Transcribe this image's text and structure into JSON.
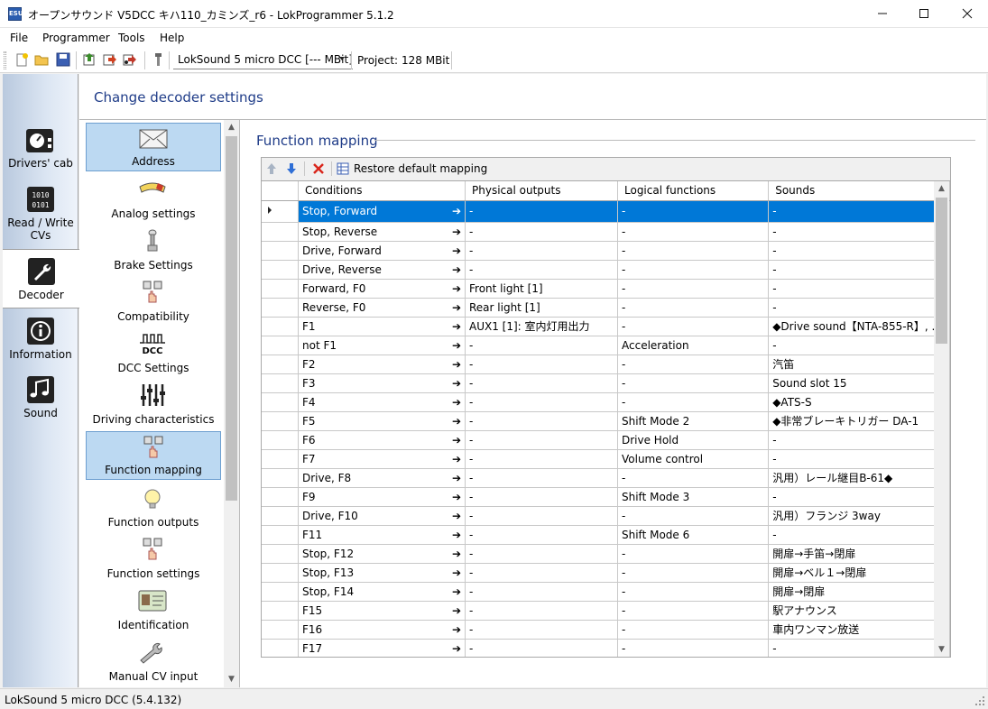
{
  "window": {
    "title": "オープンサウンド V5DCC キハ110_カミンズ_r6 - LokProgrammer 5.1.2",
    "app_icon_text": "ESU"
  },
  "menu": [
    "File",
    "Programmer",
    "Tools",
    "Help"
  ],
  "toolbar": {
    "device": "LokSound 5 micro DCC [--- MBit]",
    "project_label": "Project:",
    "project_size": "128 MBit"
  },
  "leftnav": [
    {
      "label": "Drivers' cab",
      "icon": "drivers-cab-icon"
    },
    {
      "label": "Read / Write CVs",
      "icon": "read-write-cvs-icon"
    },
    {
      "label": "Decoder",
      "icon": "decoder-wrench-icon",
      "active": true
    },
    {
      "label": "Information",
      "icon": "info-icon"
    },
    {
      "label": "Sound",
      "icon": "music-note-icon"
    }
  ],
  "main": {
    "title": "Change decoder settings"
  },
  "settings": [
    {
      "label": "Address",
      "icon": "envelope-icon",
      "selected": true
    },
    {
      "label": "Analog settings",
      "icon": "meter-icon"
    },
    {
      "label": "Brake Settings",
      "icon": "brake-lever-icon"
    },
    {
      "label": "Compatibility",
      "icon": "compatibility-icon"
    },
    {
      "label": "DCC Settings",
      "icon": "dcc-icon",
      "icon_text": "DCC"
    },
    {
      "label": "Driving characteristics",
      "icon": "sliders-icon"
    },
    {
      "label": "Function mapping",
      "icon": "function-mapping-icon",
      "selected": true
    },
    {
      "label": "Function outputs",
      "icon": "light-bulb-icon"
    },
    {
      "label": "Function settings",
      "icon": "function-settings-icon"
    },
    {
      "label": "Identification",
      "icon": "id-card-icon"
    },
    {
      "label": "Manual CV input",
      "icon": "wrench-icon"
    }
  ],
  "function_mapping": {
    "title": "Function mapping",
    "restore_label": "Restore default mapping",
    "columns": [
      "Conditions",
      "Physical outputs",
      "Logical functions",
      "Sounds"
    ],
    "rows": [
      {
        "condition": "Stop, Forward",
        "physical": "-",
        "logical": "-",
        "sounds": "-",
        "selected": true
      },
      {
        "condition": "Stop, Reverse",
        "physical": "-",
        "logical": "-",
        "sounds": "-"
      },
      {
        "condition": "Drive, Forward",
        "physical": "-",
        "logical": "-",
        "sounds": "-"
      },
      {
        "condition": "Drive, Reverse",
        "physical": "-",
        "logical": "-",
        "sounds": "-"
      },
      {
        "condition": "Forward, F0",
        "physical": "Front light [1]",
        "logical": "-",
        "sounds": "-"
      },
      {
        "condition": "Reverse, F0",
        "physical": "Rear light [1]",
        "logical": "-",
        "sounds": "-"
      },
      {
        "condition": "F1",
        "physical": "AUX1 [1]: 室内灯用出力",
        "logical": "-",
        "sounds": "◆Drive sound【NTA-855-R】, ..."
      },
      {
        "condition": "not F1",
        "physical": "-",
        "logical": "Acceleration",
        "sounds": "-"
      },
      {
        "condition": "F2",
        "physical": "-",
        "logical": "-",
        "sounds": "汽笛"
      },
      {
        "condition": "F3",
        "physical": "-",
        "logical": "-",
        "sounds": "Sound slot 15"
      },
      {
        "condition": "F4",
        "physical": "-",
        "logical": "-",
        "sounds": "◆ATS-S"
      },
      {
        "condition": "F5",
        "physical": "-",
        "logical": "Shift Mode 2",
        "sounds": "◆非常ブレーキトリガー DA-1"
      },
      {
        "condition": "F6",
        "physical": "-",
        "logical": "Drive Hold",
        "sounds": "-"
      },
      {
        "condition": "F7",
        "physical": "-",
        "logical": "Volume control",
        "sounds": "-"
      },
      {
        "condition": "Drive, F8",
        "physical": "-",
        "logical": "-",
        "sounds": "汎用）レール継目B-61◆"
      },
      {
        "condition": "F9",
        "physical": "-",
        "logical": "Shift Mode 3",
        "sounds": "-"
      },
      {
        "condition": "Drive, F10",
        "physical": "-",
        "logical": "-",
        "sounds": "汎用）フランジ 3way"
      },
      {
        "condition": "F11",
        "physical": "-",
        "logical": "Shift Mode 6",
        "sounds": "-"
      },
      {
        "condition": "Stop, F12",
        "physical": "-",
        "logical": "-",
        "sounds": "開扉→手笛→閉扉"
      },
      {
        "condition": "Stop, F13",
        "physical": "-",
        "logical": "-",
        "sounds": "開扉→ベル１→閉扉"
      },
      {
        "condition": "Stop, F14",
        "physical": "-",
        "logical": "-",
        "sounds": "開扉→閉扉"
      },
      {
        "condition": "F15",
        "physical": "-",
        "logical": "-",
        "sounds": "駅アナウンス"
      },
      {
        "condition": "F16",
        "physical": "-",
        "logical": "-",
        "sounds": "車内ワンマン放送"
      },
      {
        "condition": "F17",
        "physical": "-",
        "logical": "-",
        "sounds": "-"
      }
    ]
  },
  "statusbar": {
    "text": "LokSound 5 micro DCC (5.4.132)"
  },
  "colors": {
    "selection": "#0078d7",
    "nav_selected": "#bcd9f2",
    "heading": "#1f3c88"
  }
}
